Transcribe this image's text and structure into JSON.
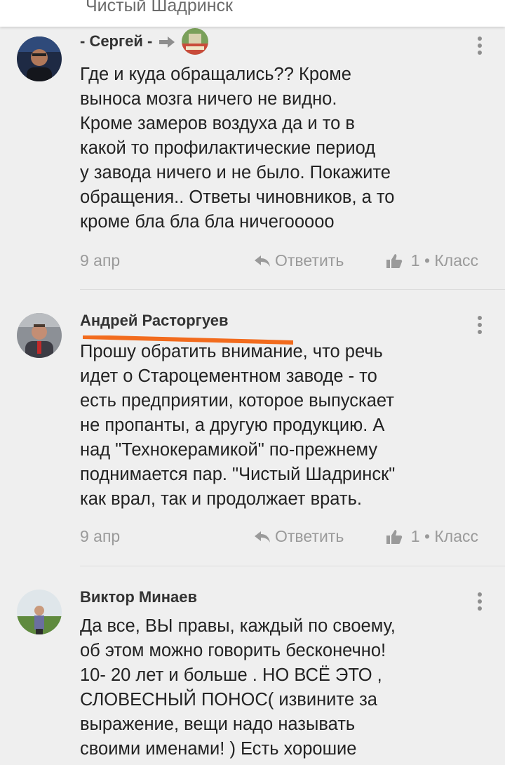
{
  "header": {
    "title": "Чистый Шадринск"
  },
  "comments": [
    {
      "author": "- Сергей -",
      "text": "Где и куда обращались?? Кроме\nвыноса мозга ничего не видно.\nКроме замеров воздуха да и то в\nкакой то профилактические период\nу завода ничего и не было. Покажите\nобращения.. Ответы чиновников, а то\nкроме бла бла бла ничегооооо",
      "date": "9 апр",
      "reply_label": "Ответить",
      "likes": "1 • Класс"
    },
    {
      "author": "Андрей Расторгуев",
      "text": "Прошу обратить внимание, что речь\nидет о Староцементном заводе - то\nесть предприятии, которое выпускает\nне пропанты, а другую продукцию. А\nнад \"Технокерамикой\" по-прежнему\nподнимается пар. \"Чистый Шадринск\"\nкак врал, так и продолжает врать.",
      "date": "9 апр",
      "reply_label": "Ответить",
      "likes": "1 • Класс"
    },
    {
      "author": "Виктор Минаев",
      "text": "Да все, ВЫ правы, каждый по своему,\nоб этом можно говорить бесконечно!\n10- 20 лет и больше . НО ВСЁ ЭТО ,\nСЛОВЕСНЫЙ ПОНОС( извините за\nвыражение, вещи надо называть\nсвоими именами! ) Есть хорошие"
    }
  ],
  "colors": {
    "background": "#efefef",
    "meta_text": "#9a9a9a",
    "underline_annotation": "#f26b1d"
  },
  "icons": [
    "kebab-menu-icon",
    "reply-arrow-icon",
    "thumbs-up-icon",
    "share-arrow-icon"
  ]
}
